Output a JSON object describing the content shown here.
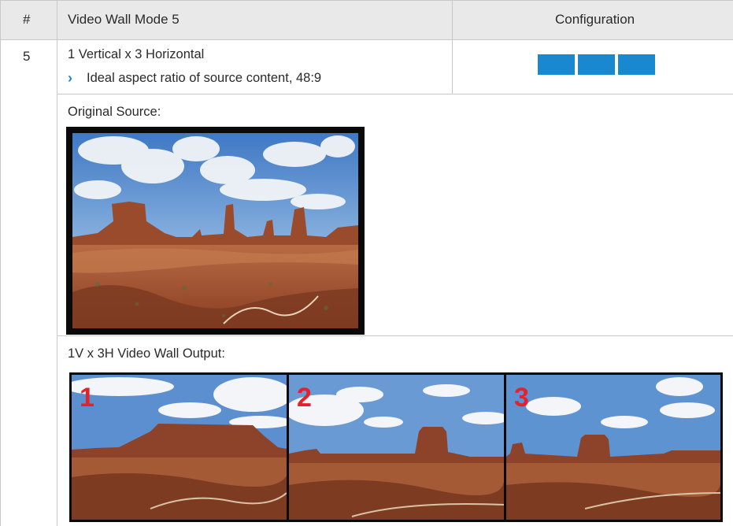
{
  "header": {
    "hash": "#",
    "title": "Video Wall Mode 5",
    "configuration": "Configuration"
  },
  "row": {
    "number": "5",
    "layout": "1 Vertical x 3 Horizontal",
    "bullet_icon": "chevron-right-icon",
    "bullet": "Ideal aspect ratio of source content, 48:9",
    "config_boxes": 3,
    "config_color": "#1a88d0"
  },
  "source": {
    "label": "Original Source:"
  },
  "output": {
    "label": "1V x 3H Video Wall Output:",
    "panels": [
      "1",
      "2",
      "3"
    ],
    "number_color": "#e5212b"
  }
}
